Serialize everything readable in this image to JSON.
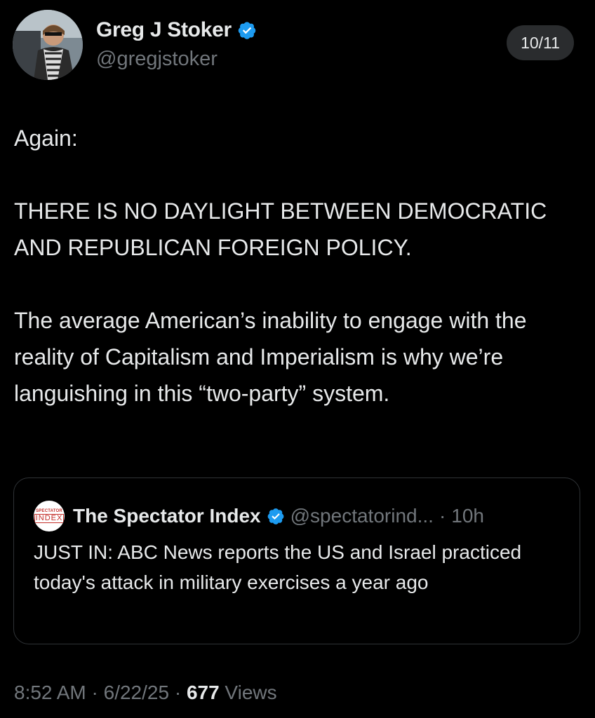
{
  "author": {
    "display_name": "Greg J Stoker",
    "handle": "@gregjstoker",
    "verified": true
  },
  "thread_counter": "10/11",
  "tweet": {
    "paragraphs": [
      "Again:",
      "THERE IS NO DAYLIGHT BETWEEN DEMOCRATIC AND REPUBLICAN FOREIGN POLICY.",
      "The average American’s inability to engage with the reality of Capitalism and Imperialism is why we’re languishing in this “two-party” system."
    ]
  },
  "quoted_tweet": {
    "logo_text_top": "SPECTATOR",
    "logo_text_bottom": "INDEX",
    "display_name": "The Spectator Index",
    "handle": "@spectatorind...",
    "separator": "·",
    "time": "10h",
    "text": "JUST IN: ABC News reports the US and Israel practiced today's attack in military exercises a year ago"
  },
  "meta": {
    "time": "8:52 AM",
    "sep1": " · ",
    "date": "6/22/25",
    "sep2": " · ",
    "views_count": "677",
    "views_label": " Views"
  },
  "colors": {
    "background": "#000000",
    "text": "#e7e9ea",
    "muted": "#71767b",
    "verified": "#1d9bf0",
    "border": "#2f3336"
  }
}
